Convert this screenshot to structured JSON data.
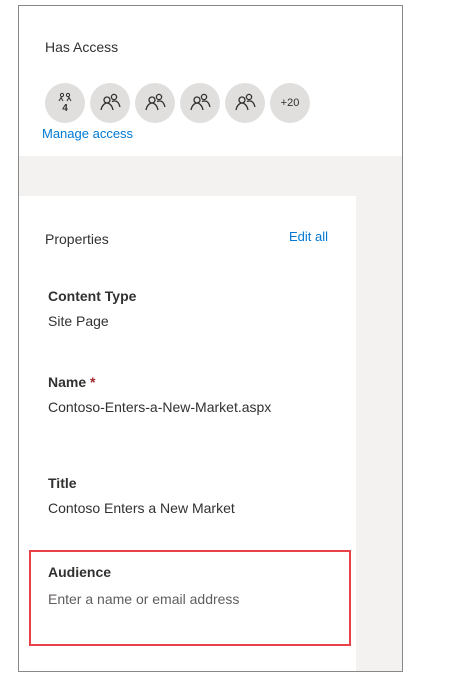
{
  "access": {
    "title": "Has Access",
    "group_count": "4",
    "more_label": "+20",
    "manage_link": "Manage access"
  },
  "properties": {
    "title": "Properties",
    "edit_all": "Edit all",
    "fields": [
      {
        "label": "Content Type",
        "value": "Site Page"
      },
      {
        "label": "Name",
        "required_mark": "*",
        "value": "Contoso-Enters-a-New-Market.aspx"
      },
      {
        "label": "Title",
        "value": "Contoso Enters a New Market"
      }
    ],
    "audience": {
      "label": "Audience",
      "placeholder": "Enter a name or email address"
    }
  },
  "colors": {
    "link": "#0078d4",
    "highlight": "#e8414a",
    "panel_gray": "#f3f2f1",
    "avatar_bg": "#e1dfdd"
  },
  "icons": [
    "group-icon",
    "person-icon"
  ]
}
